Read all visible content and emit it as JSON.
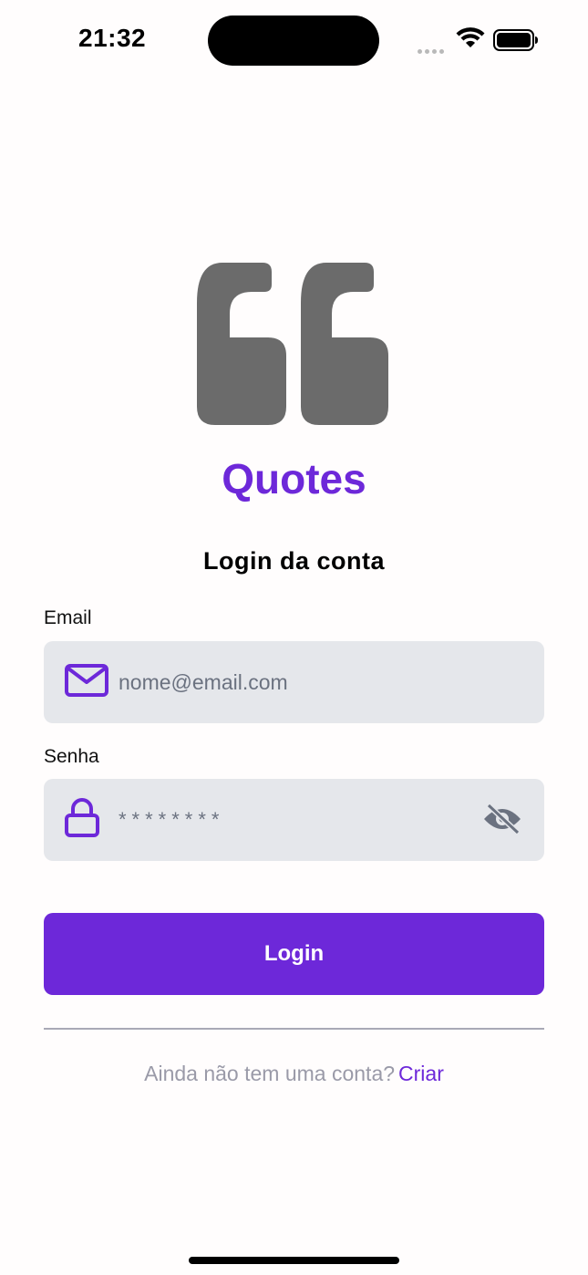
{
  "status_bar": {
    "time": "21:32"
  },
  "brand": {
    "logo_icon": "quote-mark-icon",
    "title": "Quotes",
    "accent_color": "#6d28d9"
  },
  "form": {
    "heading": "Login da conta",
    "email": {
      "label": "Email",
      "placeholder": "nome@email.com",
      "icon": "mail-icon"
    },
    "password": {
      "label": "Senha",
      "masked_value": "********",
      "icon": "lock-icon",
      "toggle_icon": "eye-off-icon"
    },
    "submit_label": "Login"
  },
  "footer": {
    "prompt": "Ainda não tem uma conta?",
    "link": "Criar"
  }
}
